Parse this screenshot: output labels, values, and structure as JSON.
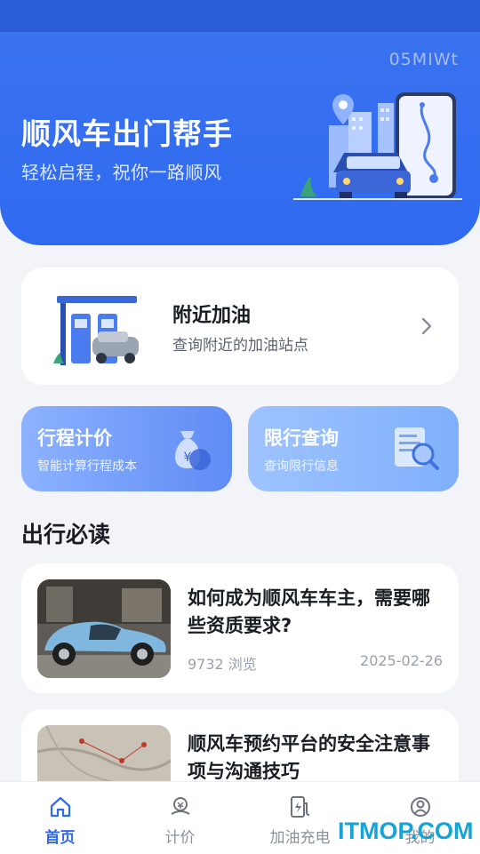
{
  "hero": {
    "watermark": "05MIWt",
    "title": "顺风车出门帮手",
    "subtitle": "轻松启程，祝你一路顺风"
  },
  "nearby": {
    "title": "附近加油",
    "subtitle": "查询附近的加油站点"
  },
  "tiles": [
    {
      "title": "行程计价",
      "subtitle": "智能计算行程成本",
      "icon": "money-bag-icon"
    },
    {
      "title": "限行查询",
      "subtitle": "查询限行信息",
      "icon": "document-search-icon"
    }
  ],
  "section": {
    "title": "出行必读"
  },
  "articles": [
    {
      "title": "如何成为顺风车车主，需要哪些资质要求?",
      "views": "9732 浏览",
      "date": "2025-02-26"
    },
    {
      "title": "顺风车预约平台的安全注意事项与沟通技巧"
    }
  ],
  "tabbar": {
    "items": [
      {
        "label": "首页",
        "icon": "home-icon",
        "active": true
      },
      {
        "label": "计价",
        "icon": "price-icon",
        "active": false
      },
      {
        "label": "加油充电",
        "icon": "fuel-charge-icon",
        "active": false
      },
      {
        "label": "我的",
        "icon": "profile-icon",
        "active": false
      }
    ]
  },
  "brand_mark": "ITMOP.COM",
  "colors": {
    "primary": "#2f6af0",
    "status_bar": "#2a5cd6",
    "background": "#f3f4f7"
  }
}
